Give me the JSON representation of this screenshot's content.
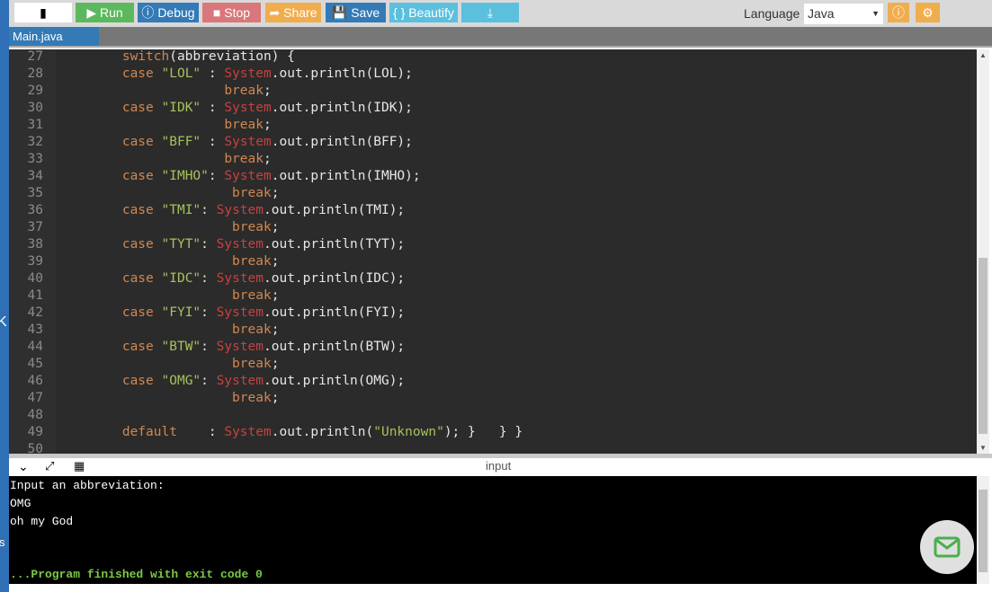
{
  "toolbar": {
    "run": "Run",
    "debug": "Debug",
    "stop": "Stop",
    "share": "Share",
    "save": "Save",
    "beautify": "{ } Beautify",
    "language_label": "Language",
    "language_value": "Java"
  },
  "tab": {
    "name": "Main.java"
  },
  "sidebar": {
    "glyph1": "K",
    "glyph2": "s"
  },
  "editor": {
    "lines": [
      {
        "n": "27",
        "t": [
          [
            "kw",
            "        switch"
          ],
          [
            "tx",
            "(abbreviation) {"
          ]
        ]
      },
      {
        "n": "28",
        "t": [
          [
            "kw",
            "        case "
          ],
          [
            "str",
            "\"LOL\""
          ],
          [
            "tx",
            " : "
          ],
          [
            "sys",
            "System"
          ],
          [
            "tx",
            ".out.println(LOL);"
          ]
        ]
      },
      {
        "n": "29",
        "t": [
          [
            "kw",
            "                     break"
          ],
          [
            "tx",
            ";"
          ]
        ]
      },
      {
        "n": "30",
        "t": [
          [
            "kw",
            "        case "
          ],
          [
            "str",
            "\"IDK\""
          ],
          [
            "tx",
            " : "
          ],
          [
            "sys",
            "System"
          ],
          [
            "tx",
            ".out.println(IDK);"
          ]
        ]
      },
      {
        "n": "31",
        "t": [
          [
            "kw",
            "                     break"
          ],
          [
            "tx",
            ";"
          ]
        ]
      },
      {
        "n": "32",
        "t": [
          [
            "kw",
            "        case "
          ],
          [
            "str",
            "\"BFF\""
          ],
          [
            "tx",
            " : "
          ],
          [
            "sys",
            "System"
          ],
          [
            "tx",
            ".out.println(BFF);"
          ]
        ]
      },
      {
        "n": "33",
        "t": [
          [
            "kw",
            "                     break"
          ],
          [
            "tx",
            ";"
          ]
        ]
      },
      {
        "n": "34",
        "t": [
          [
            "kw",
            "        case "
          ],
          [
            "str",
            "\"IMHO\""
          ],
          [
            "tx",
            ": "
          ],
          [
            "sys",
            "System"
          ],
          [
            "tx",
            ".out.println(IMHO);"
          ]
        ]
      },
      {
        "n": "35",
        "t": [
          [
            "kw",
            "                      break"
          ],
          [
            "tx",
            ";"
          ]
        ]
      },
      {
        "n": "36",
        "t": [
          [
            "kw",
            "        case "
          ],
          [
            "str",
            "\"TMI\""
          ],
          [
            "tx",
            ": "
          ],
          [
            "sys",
            "System"
          ],
          [
            "tx",
            ".out.println(TMI);"
          ]
        ]
      },
      {
        "n": "37",
        "t": [
          [
            "kw",
            "                      break"
          ],
          [
            "tx",
            ";"
          ]
        ]
      },
      {
        "n": "38",
        "t": [
          [
            "kw",
            "        case "
          ],
          [
            "str",
            "\"TYT\""
          ],
          [
            "tx",
            ": "
          ],
          [
            "sys",
            "System"
          ],
          [
            "tx",
            ".out.println(TYT);"
          ]
        ]
      },
      {
        "n": "39",
        "t": [
          [
            "kw",
            "                      break"
          ],
          [
            "tx",
            ";"
          ]
        ]
      },
      {
        "n": "40",
        "t": [
          [
            "kw",
            "        case "
          ],
          [
            "str",
            "\"IDC\""
          ],
          [
            "tx",
            ": "
          ],
          [
            "sys",
            "System"
          ],
          [
            "tx",
            ".out.println(IDC);"
          ]
        ]
      },
      {
        "n": "41",
        "t": [
          [
            "kw",
            "                      break"
          ],
          [
            "tx",
            ";"
          ]
        ]
      },
      {
        "n": "42",
        "t": [
          [
            "kw",
            "        case "
          ],
          [
            "str",
            "\"FYI\""
          ],
          [
            "tx",
            ": "
          ],
          [
            "sys",
            "System"
          ],
          [
            "tx",
            ".out.println(FYI);"
          ]
        ]
      },
      {
        "n": "43",
        "t": [
          [
            "kw",
            "                      break"
          ],
          [
            "tx",
            ";"
          ]
        ]
      },
      {
        "n": "44",
        "t": [
          [
            "kw",
            "        case "
          ],
          [
            "str",
            "\"BTW\""
          ],
          [
            "tx",
            ": "
          ],
          [
            "sys",
            "System"
          ],
          [
            "tx",
            ".out.println(BTW);"
          ]
        ]
      },
      {
        "n": "45",
        "t": [
          [
            "kw",
            "                      break"
          ],
          [
            "tx",
            ";"
          ]
        ]
      },
      {
        "n": "46",
        "t": [
          [
            "kw",
            "        case "
          ],
          [
            "str",
            "\"OMG\""
          ],
          [
            "tx",
            ": "
          ],
          [
            "sys",
            "System"
          ],
          [
            "tx",
            ".out.println(OMG);"
          ]
        ]
      },
      {
        "n": "47",
        "t": [
          [
            "kw",
            "                      break"
          ],
          [
            "tx",
            ";"
          ]
        ]
      },
      {
        "n": "48",
        "t": []
      },
      {
        "n": "49",
        "t": [
          [
            "kw",
            "        default"
          ],
          [
            "tx",
            "    : "
          ],
          [
            "sys",
            "System"
          ],
          [
            "tx",
            ".out.println("
          ],
          [
            "str",
            "\"Unknown\""
          ],
          [
            "tx",
            "); }   } }"
          ]
        ]
      },
      {
        "n": "50",
        "t": []
      }
    ]
  },
  "output": {
    "title": "input",
    "lines": [
      "Input an abbreviation:",
      "OMG",
      "oh my God"
    ],
    "finish": "...Program finished with exit code 0"
  }
}
